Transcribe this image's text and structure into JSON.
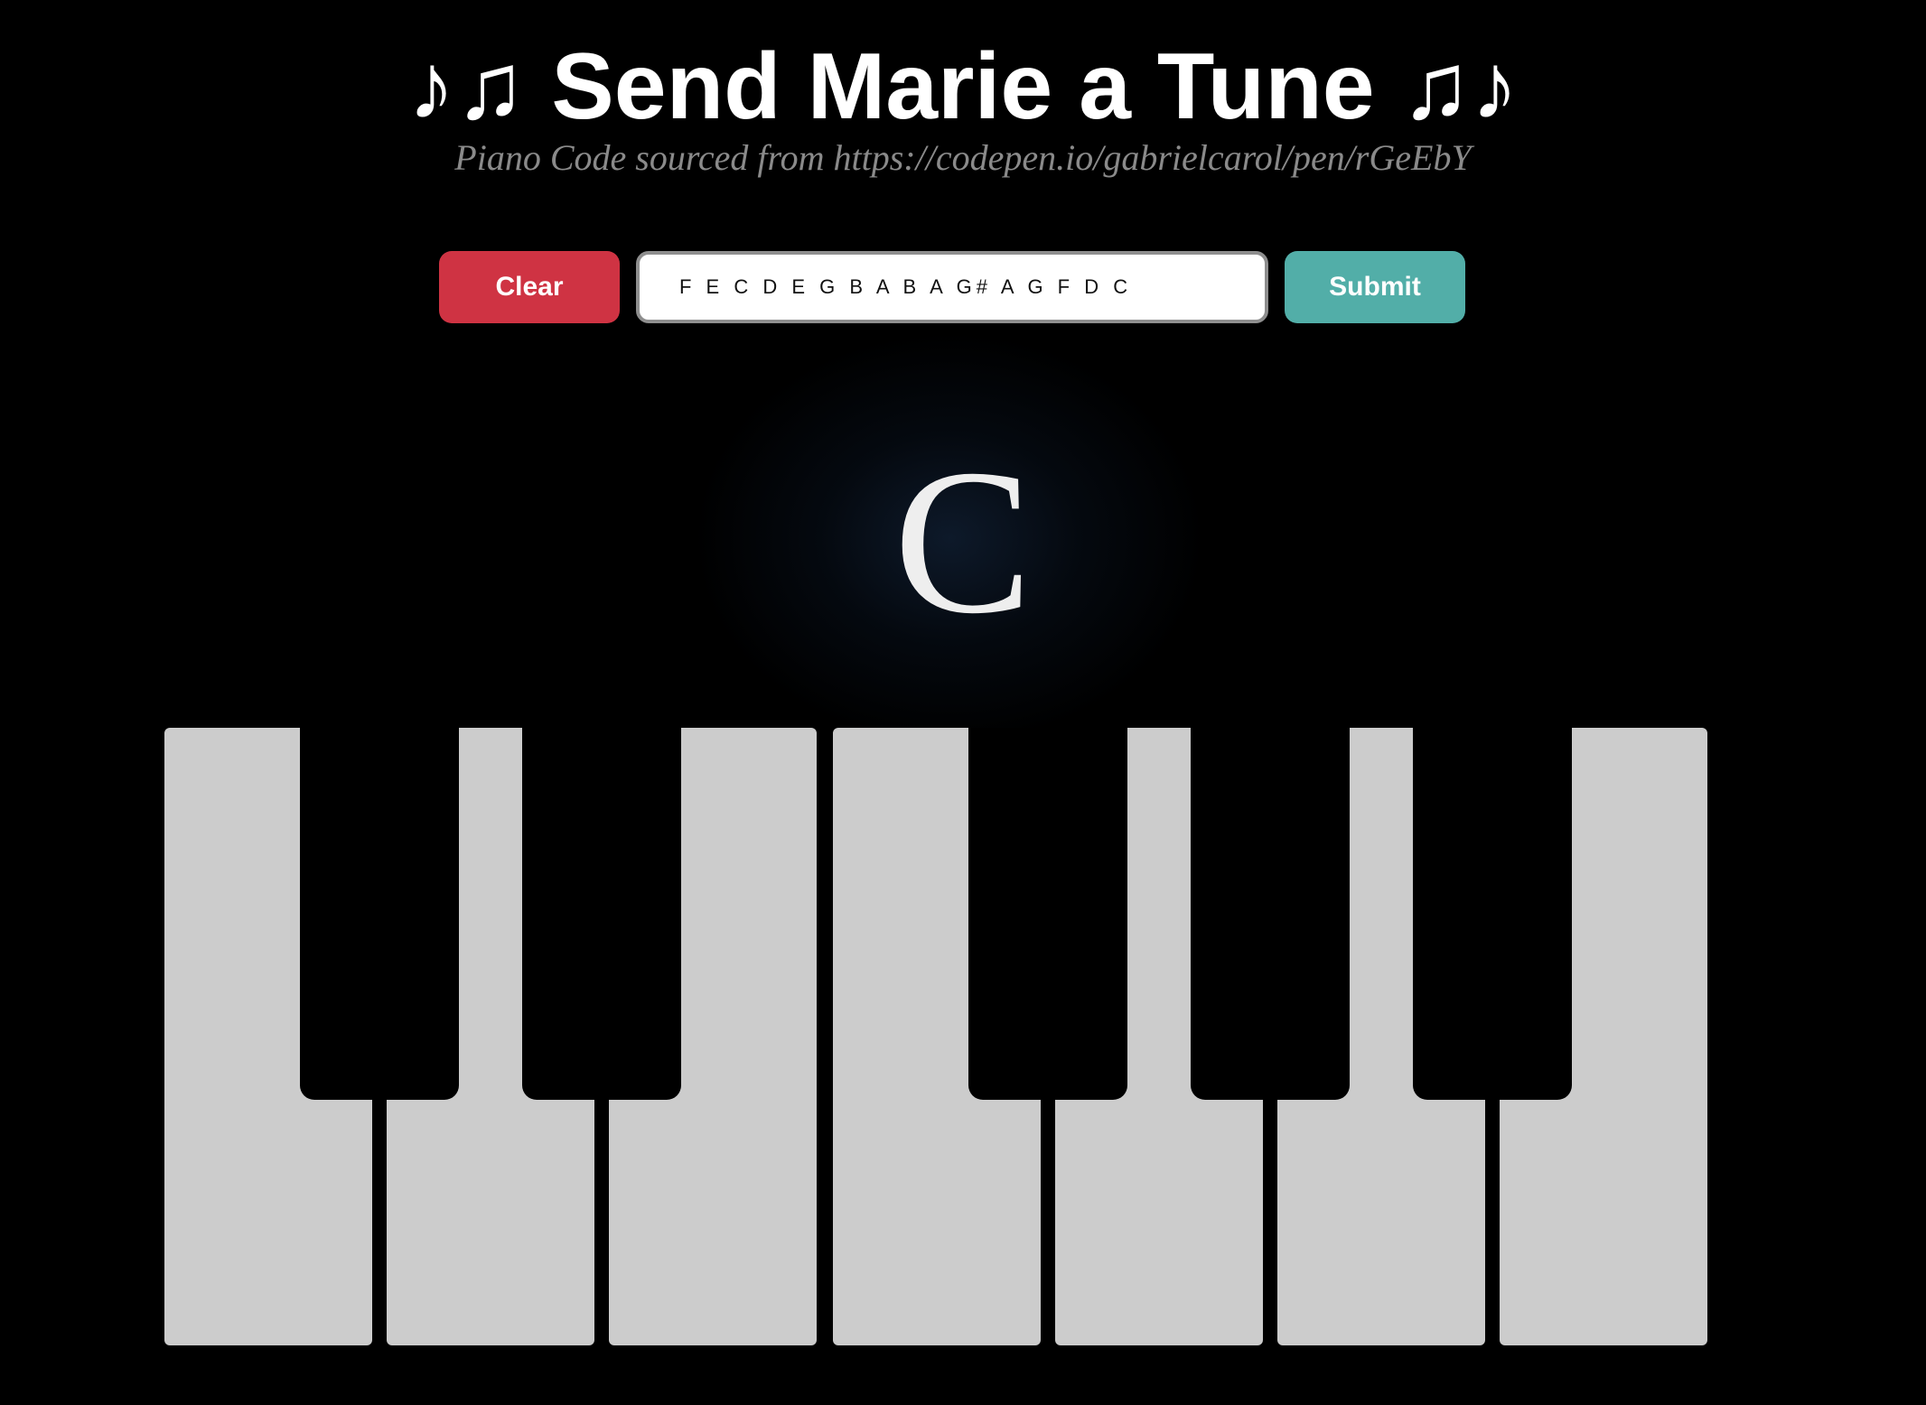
{
  "header": {
    "title": "♪♫ Send Marie a Tune ♫♪",
    "subtitle": "Piano Code sourced from https://codepen.io/gabrielcarol/pen/rGeEbY"
  },
  "controls": {
    "clear_label": "Clear",
    "notes_value": "F E C D E G B A B A G# A G F D C",
    "submit_label": "Submit"
  },
  "display": {
    "current_note": "C"
  },
  "colors": {
    "background": "#000000",
    "clear_button": "#cf3343",
    "submit_button": "#52aea8",
    "white_key": "#cccccc",
    "black_key": "#000000"
  }
}
